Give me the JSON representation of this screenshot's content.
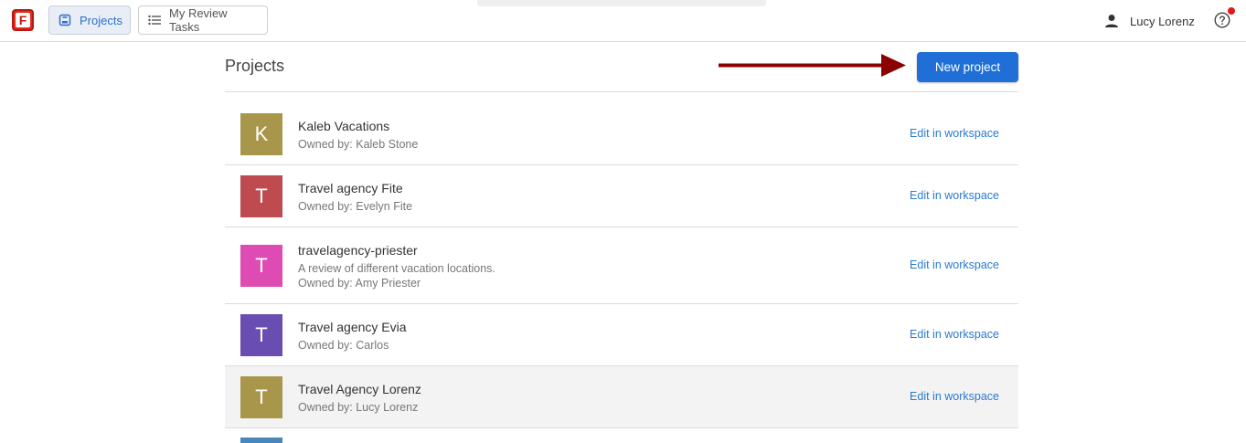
{
  "topbar": {
    "nav": {
      "projects_label": "Projects",
      "tasks_label": "My Review Tasks"
    },
    "user_name": "Lucy Lorenz"
  },
  "header": {
    "title": "Projects",
    "new_button_label": "New project"
  },
  "projects": [
    {
      "initial": "K",
      "name": "Kaleb Vacations",
      "description": "",
      "owner": "Owned by: Kaleb Stone",
      "avatar_color": "#a8974a",
      "edit_label": "Edit in workspace"
    },
    {
      "initial": "T",
      "name": "Travel agency Fite",
      "description": "",
      "owner": "Owned by: Evelyn Fite",
      "avatar_color": "#be4b4f",
      "edit_label": "Edit in workspace"
    },
    {
      "initial": "T",
      "name": "travelagency-priester",
      "description": "A review of different vacation locations.",
      "owner": "Owned by: Amy Priester",
      "avatar_color": "#de4bb2",
      "edit_label": "Edit in workspace"
    },
    {
      "initial": "T",
      "name": "Travel agency Evia",
      "description": "",
      "owner": "Owned by: Carlos",
      "avatar_color": "#694db0",
      "edit_label": "Edit in workspace"
    },
    {
      "initial": "T",
      "name": "Travel Agency Lorenz",
      "description": "",
      "owner": "Owned by: Lucy Lorenz",
      "avatar_color": "#a8974a",
      "edit_label": "Edit in workspace"
    }
  ],
  "colors": {
    "accent": "#1f6fd6",
    "link": "#2a7ad0",
    "annotation_arrow": "#8b0000",
    "notification_dot": "#e0191e"
  }
}
